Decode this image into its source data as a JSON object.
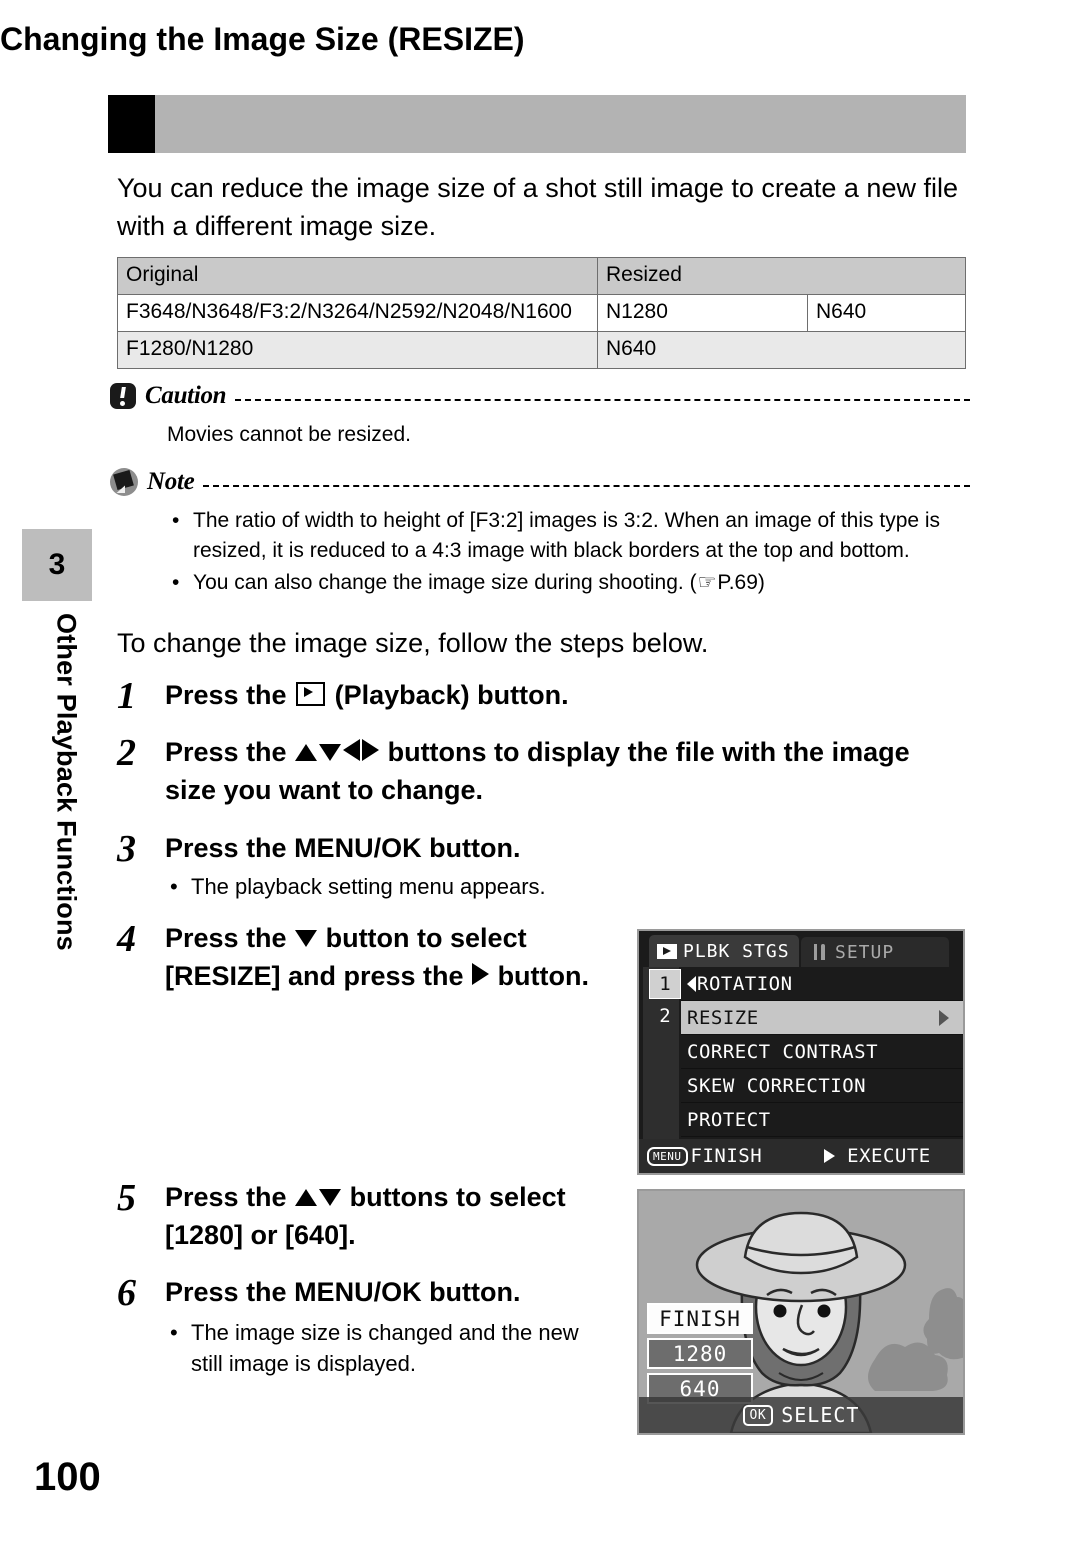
{
  "sidebar": {
    "chapter_number": "3",
    "chapter_title": "Other Playback Functions"
  },
  "header": {
    "title": "Changing the Image Size (RESIZE)"
  },
  "intro": "You can reduce the image size of a shot still image to create a new file with a different image size.",
  "table": {
    "headers": [
      "Original",
      "Resized"
    ],
    "rows": [
      {
        "original": "F3648/N3648/F3:2/N3264/N2592/N2048/N1600",
        "resized_1": "N1280",
        "resized_2": "N640"
      },
      {
        "original": "F1280/N1280",
        "resized_1": "N640",
        "resized_2": ""
      }
    ]
  },
  "caution": {
    "title": "Caution",
    "body": "Movies cannot be resized."
  },
  "note": {
    "title": "Note",
    "bullets": [
      "The ratio of width to height of [F3:2] images is 3:2. When an image of this type is resized, it is reduced to a 4:3 image with black borders at the top and bottom.",
      "You can also change the image size during shooting. ("
    ],
    "page_ref": "P.69",
    "page_ref_close": ")"
  },
  "lead": "To change the image size, follow the steps below.",
  "steps": [
    {
      "num": "1",
      "text_a": "Press the ",
      "text_b": " (Playback) button."
    },
    {
      "num": "2",
      "text_a": "Press the ",
      "text_b": " buttons to display the file with the image size you want to change."
    },
    {
      "num": "3",
      "text_a": "Press the MENU/OK button.",
      "text_b": ""
    },
    {
      "num": "4",
      "text_a": "Press the ",
      "text_b": " button to select [RESIZE] and press the ",
      "text_c": " button."
    },
    {
      "num": "5",
      "text_a": "Press the ",
      "text_b": " buttons to select [1280] or [640]."
    },
    {
      "num": "6",
      "text_a": "Press the MENU/OK button.",
      "text_b": ""
    }
  ],
  "subnotes": {
    "step3": "The playback setting menu appears.",
    "step6": "The image size is changed and the new still image is displayed."
  },
  "lcd_menu": {
    "tab_active": "PLBK STGS",
    "tab_inactive": "SETUP",
    "page_numbers": [
      "1",
      "2"
    ],
    "items": [
      {
        "label": "ROTATION",
        "selected": false,
        "has_left_caret": true,
        "has_right_caret": false
      },
      {
        "label": "RESIZE",
        "selected": true,
        "has_left_caret": false,
        "has_right_caret": true
      },
      {
        "label": "CORRECT CONTRAST",
        "selected": false,
        "has_left_caret": false,
        "has_right_caret": false
      },
      {
        "label": "SKEW CORRECTION",
        "selected": false,
        "has_left_caret": false,
        "has_right_caret": false
      },
      {
        "label": "PROTECT",
        "selected": false,
        "has_left_caret": false,
        "has_right_caret": false
      }
    ],
    "footer_menu_badge": "MENU",
    "footer_finish": "FINISH",
    "footer_execute": "EXECUTE"
  },
  "lcd_photo": {
    "options": [
      {
        "label": "FINISH",
        "selected": true
      },
      {
        "label": "1280",
        "selected": false
      },
      {
        "label": "640",
        "selected": false
      }
    ],
    "footer_badge": "OK",
    "footer_label": "SELECT"
  },
  "page_number": "100",
  "colors": {
    "header_bar": "#b3b3b3",
    "table_header": "#c9c9c9",
    "table_alt_row": "#e9e9e9",
    "sidebar_tab": "#bdbdbd",
    "lcd_background": "#1b1b1b",
    "lcd_selected": "#c6c6c6"
  }
}
